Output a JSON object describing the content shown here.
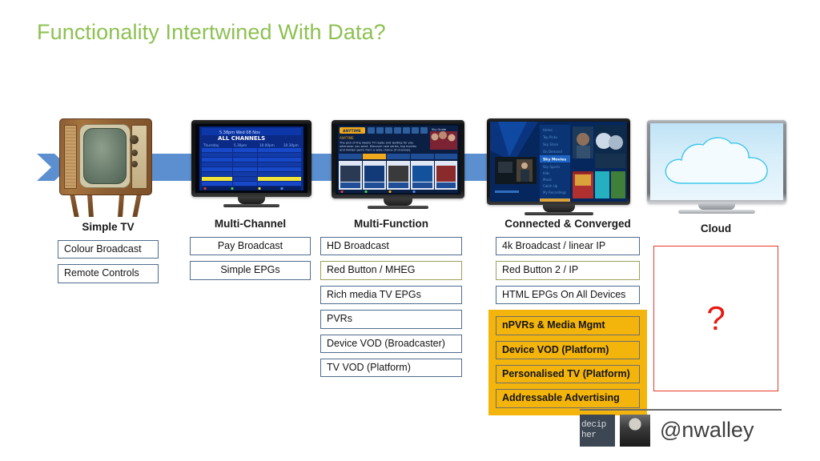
{
  "slide": {
    "title": "Functionality Intertwined With Data?",
    "title_color": "#8dc152",
    "background": "#ffffff"
  },
  "arrow": {
    "name": "evolution-arrow",
    "color": "#5b8fd0",
    "direction": "right"
  },
  "columns": [
    {
      "id": "simple-tv",
      "label": "Simple TV",
      "device": "vintage-crt-television",
      "boxes": [
        {
          "label": "Colour Broadcast",
          "style": "blue",
          "align": "left"
        },
        {
          "label": "Remote Controls",
          "style": "blue",
          "align": "left"
        }
      ],
      "highlight": []
    },
    {
      "id": "multi-channel",
      "label": "Multi-Channel",
      "device": "flat-tv-epg-grid",
      "boxes": [
        {
          "label": "Pay Broadcast",
          "style": "blue",
          "align": "center"
        },
        {
          "label": "Simple EPGs",
          "style": "blue",
          "align": "center"
        }
      ],
      "highlight": []
    },
    {
      "id": "multi-function",
      "label": "Multi-Function",
      "device": "flat-tv-interactive-portal",
      "boxes": [
        {
          "label": "HD Broadcast",
          "style": "blue",
          "align": "left"
        },
        {
          "label": "Red Button / MHEG",
          "style": "olive",
          "align": "left"
        },
        {
          "label": "Rich media TV EPGs",
          "style": "blue",
          "align": "left"
        },
        {
          "label": "PVRs",
          "style": "blue",
          "align": "left"
        },
        {
          "label": "Device VOD (Broadcaster)",
          "style": "blue",
          "align": "left"
        },
        {
          "label": "TV VOD (Platform)",
          "style": "blue",
          "align": "left"
        }
      ],
      "highlight": []
    },
    {
      "id": "connected-converged",
      "label": "Connected & Converged",
      "device": "smart-tv-content-browser",
      "boxes": [
        {
          "label": "4k Broadcast / linear IP",
          "style": "blue",
          "align": "left"
        },
        {
          "label": "Red Button 2 / IP",
          "style": "olive",
          "align": "left"
        },
        {
          "label": "HTML EPGs On All Devices",
          "style": "blue",
          "align": "left"
        }
      ],
      "highlight": [
        {
          "label": "nPVRs & Media Mgmt"
        },
        {
          "label": "Device VOD (Platform)"
        },
        {
          "label": "Personalised TV (Platform)"
        },
        {
          "label": "Addressable Advertising"
        }
      ],
      "highlight_color": "#f3b40b"
    },
    {
      "id": "cloud",
      "label": "Cloud",
      "device": "silver-tv-cloud-screen",
      "boxes": [],
      "highlight": []
    }
  ],
  "question_box": {
    "name": "future-question-box",
    "symbol": "?",
    "border_color": "#e8392b",
    "symbol_color": "#e8180f"
  },
  "footer": {
    "brand_logo_text_line1": "decip",
    "brand_logo_text_line2": "her",
    "handle": "@nwalley"
  }
}
